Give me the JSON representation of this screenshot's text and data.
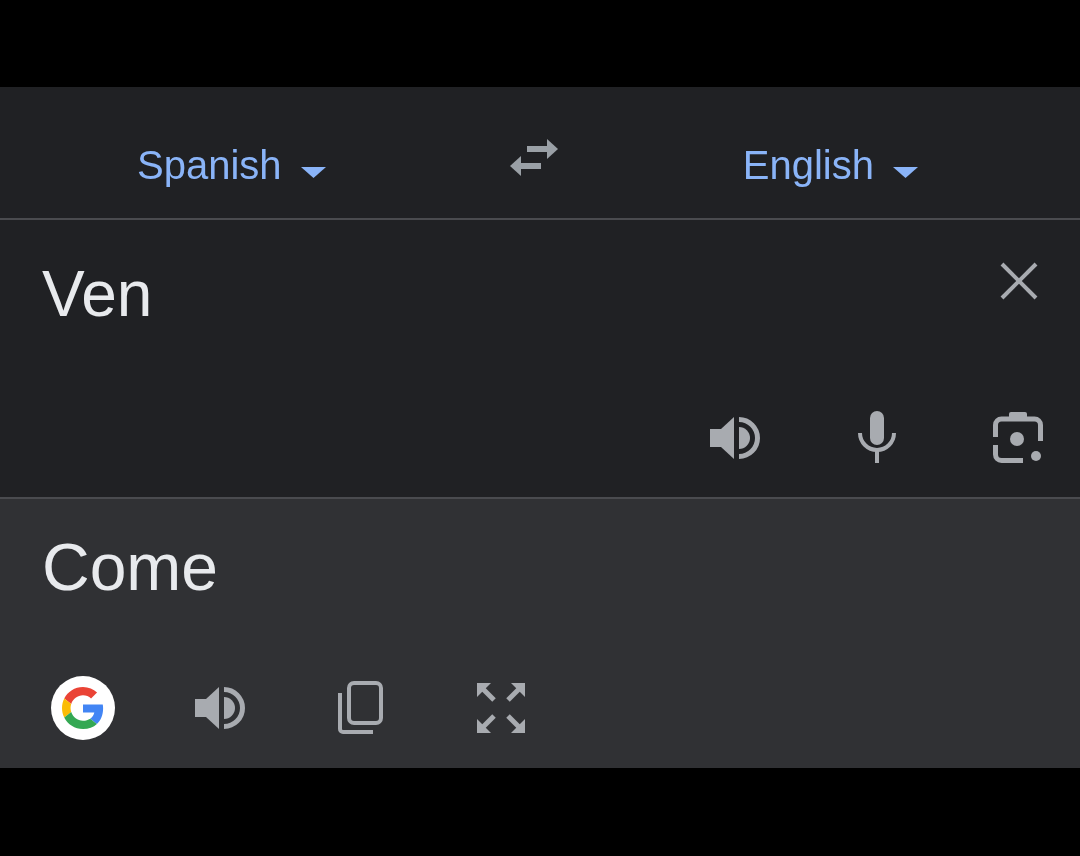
{
  "source_language": {
    "label": "Spanish"
  },
  "target_language": {
    "label": "English"
  },
  "input": {
    "value": "Ven"
  },
  "output": {
    "text": "Come"
  }
}
